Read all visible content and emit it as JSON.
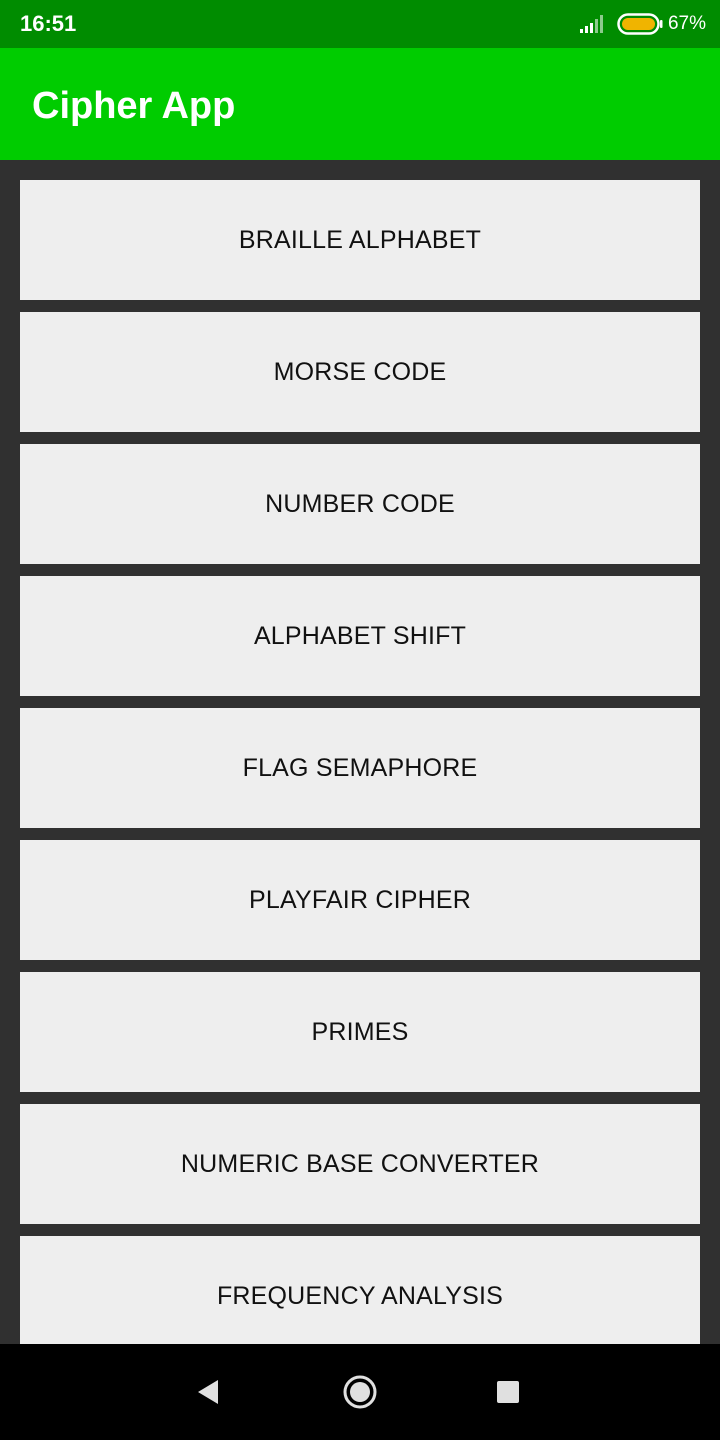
{
  "status_bar": {
    "time": "16:51",
    "battery_percent": "67%",
    "battery_level": 0.67,
    "icons": [
      "signal-icon",
      "battery-icon"
    ]
  },
  "app_bar": {
    "title": "Cipher App"
  },
  "menu": {
    "items": [
      {
        "label": "BRAILLE ALPHABET"
      },
      {
        "label": "MORSE CODE"
      },
      {
        "label": "NUMBER CODE"
      },
      {
        "label": "ALPHABET SHIFT"
      },
      {
        "label": "FLAG SEMAPHORE"
      },
      {
        "label": "PLAYFAIR CIPHER"
      },
      {
        "label": "PRIMES"
      },
      {
        "label": "NUMERIC BASE CONVERTER"
      },
      {
        "label": "FREQUENCY ANALYSIS"
      }
    ]
  },
  "nav_bar": {
    "icons": [
      "back-icon",
      "home-icon",
      "recents-icon"
    ]
  },
  "colors": {
    "status_bar": "#008c00",
    "app_bar": "#00cc00",
    "background": "#303030",
    "button": "#eeeeee",
    "battery_fill": "#f0b400"
  }
}
